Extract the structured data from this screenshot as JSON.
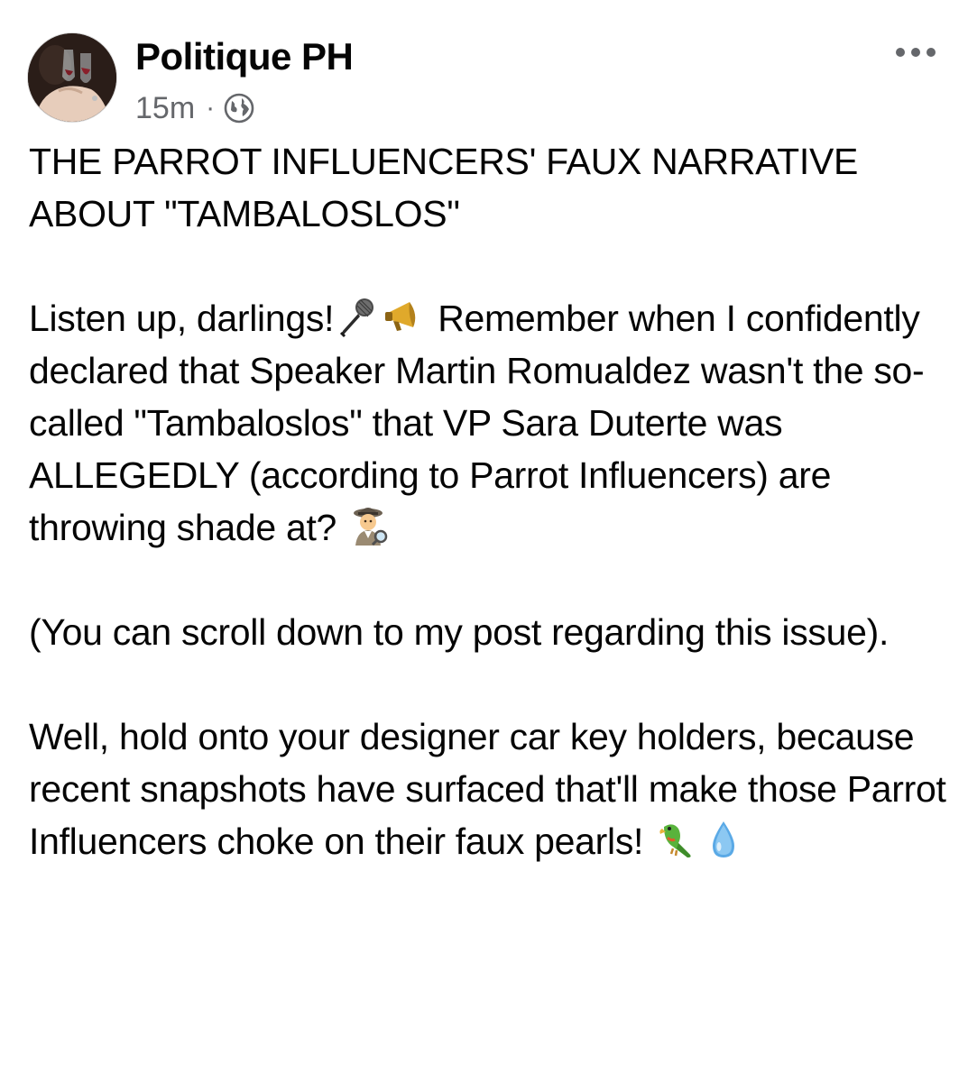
{
  "post": {
    "author": "Politique PH",
    "timestamp": "15m",
    "separator": "·",
    "audience_icon": "globe-icon",
    "menu_icon": "more-options-icon"
  },
  "content": {
    "p1": "THE PARROT INFLUENCERS' FAUX NARRATIVE ABOUT \"TAMBALOSLOS\"",
    "p2_a": "Listen up, darlings!",
    "p2_emojis_1": [
      "microphone-icon",
      "megaphone-icon"
    ],
    "p2_b": "Remember when I confidently declared that Speaker Martin Romualdez wasn't the so-called \"Tambaloslos\" that VP Sara Duterte was ALLEGEDLY (according to Parrot Influencers) are throwing shade at?",
    "p2_emojis_2": [
      "detective-icon"
    ],
    "p3": "(You can scroll down to my post regarding this issue).",
    "p4": "Well, hold onto your designer car key holders, because recent snapshots have surfaced that'll make those Parrot Influencers choke on their faux pearls!",
    "p4_emojis": [
      "parrot-icon",
      "droplet-icon"
    ]
  },
  "colors": {
    "text": "#050505",
    "meta": "#65676b",
    "background": "#ffffff"
  }
}
